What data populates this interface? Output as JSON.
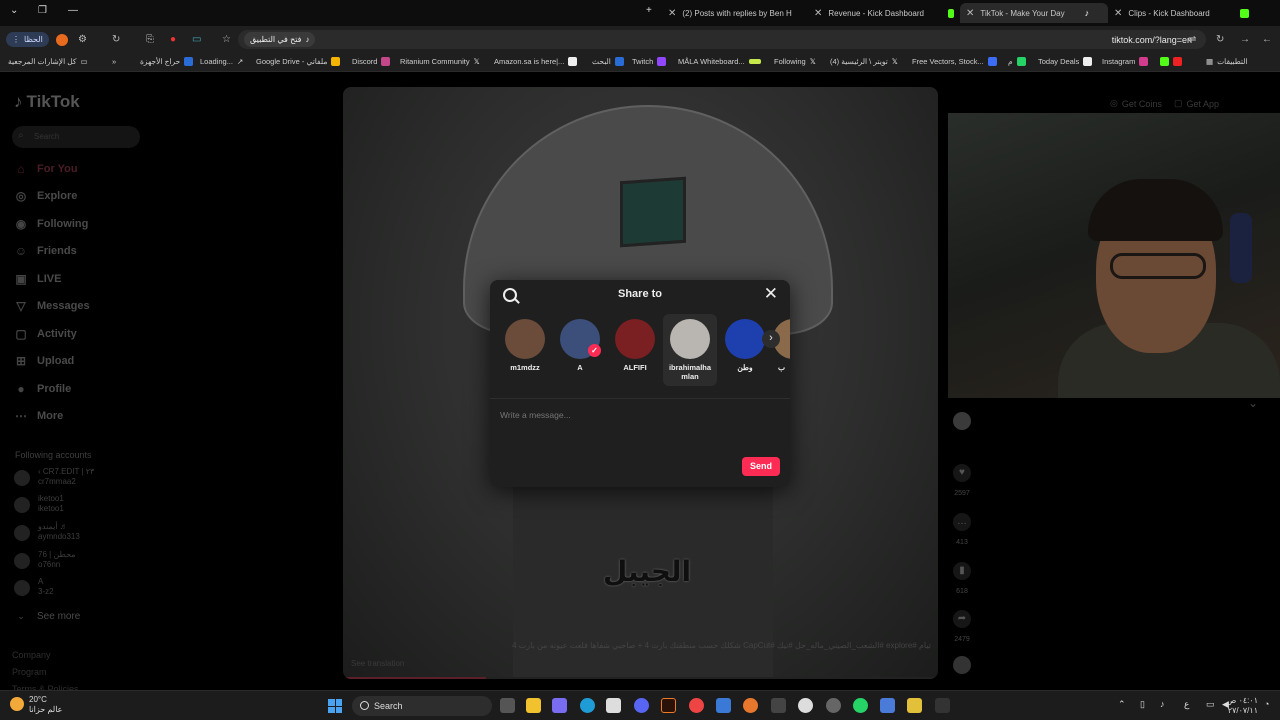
{
  "browser": {
    "tabs": [
      {
        "title": "(2) Posts with replies by Ben He",
        "active": false
      },
      {
        "title": "Revenue - Kick Dashboard",
        "active": false
      },
      {
        "title": "TikTok - Make Your Day",
        "active": true
      },
      {
        "title": "Clips - Kick Dashboard",
        "active": false
      }
    ],
    "menu_label": "الحظا",
    "open_in_app": "فتح في التطبيق",
    "url": "tiktok.com/?lang=en",
    "bookmarks": [
      "التطبيقات",
      "Instagram",
      "Today Deals",
      "م",
      "Free Vectors, Stock...",
      "(4) تويتر \\ الرئيسية",
      "Following",
      "MÅLA Whiteboard...",
      "Twitch",
      "البحث",
      "Amazon.sa is here|...",
      "Ritanium Community",
      "Discord",
      "Google Drive - ملفاتي",
      "Loading...",
      "حراج الأجهزة",
      "كل الإشارات المرجعية"
    ]
  },
  "sidebar": {
    "logo": "TikTok",
    "search_placeholder": "Search",
    "nav": [
      "For You",
      "Explore",
      "Following",
      "Friends",
      "LIVE",
      "Messages",
      "Activity",
      "Upload",
      "Profile",
      "More"
    ],
    "following_title": "Following accounts",
    "following": [
      {
        "name": "‹ CR7.EDIT | ٢٣",
        "handle": "cr7mmaa2"
      },
      {
        "name": "iketoo1",
        "handle": "iketoo1"
      },
      {
        "name": "أيمندو ♬",
        "handle": "aymndo313"
      },
      {
        "name": "76 | محطن",
        "handle": "o76nn"
      },
      {
        "name": "A",
        "handle": "3-z2"
      }
    ],
    "see_more": "See more",
    "footer": [
      "Company",
      "Program",
      "Terms & Policies"
    ]
  },
  "video": {
    "subtitle": "الجيبل",
    "caption": "تيام #explore #الشعب_الصيني_ماله_حل #تيك #CapCut شكلك حسب منطقتك بارت 4 + صاحبي شفاها قلعت عيونه من بارت 4",
    "see_translation": "See translation",
    "progress_fraction": 0.24
  },
  "top_actions": {
    "get_coins": "Get Coins",
    "get_app": "Get App"
  },
  "actions": {
    "likes": "2597",
    "comments": "413",
    "saves": "618",
    "shares": "2479"
  },
  "share_modal": {
    "title": "Share to",
    "contacts": [
      {
        "name": "m1mdzz",
        "color": "#6b4c3a",
        "selected": false,
        "checked": false
      },
      {
        "name": "A",
        "color": "#3b4f7a",
        "selected": false,
        "checked": true
      },
      {
        "name": "ALFIFI",
        "color": "#7a1f22",
        "selected": false,
        "checked": false
      },
      {
        "name": "ibrahimalhamlan",
        "color": "#b9b6b1",
        "selected": true,
        "checked": false
      },
      {
        "name": "وطن",
        "color": "#1e3fae",
        "selected": false,
        "checked": false
      },
      {
        "name": "ب",
        "color": "#8a6a4a",
        "selected": false,
        "checked": false
      }
    ],
    "message_placeholder": "Write a message...",
    "send_label": "Send"
  },
  "taskbar": {
    "temp": "20°C",
    "weather_text": "عالم حزانا",
    "search_label": "Search",
    "lang": "ع",
    "time": "٠٤:٠١ ص",
    "date": "٢٧/٠٧/١١"
  }
}
